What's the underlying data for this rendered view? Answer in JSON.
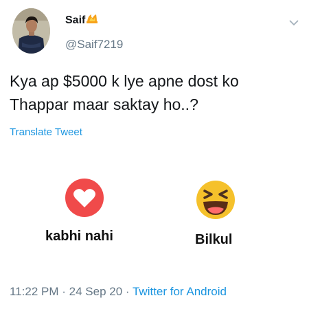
{
  "user": {
    "name": "Saif",
    "handle": "@Saif7219"
  },
  "tweet": {
    "line1": "Kya ap $5000 k lye apne dost ko",
    "line2": "Thappar maar saktay ho..?",
    "translate_label": "Translate Tweet"
  },
  "options": [
    {
      "label": "kabhi nahi",
      "icon": "heart-reaction-icon",
      "color": "#f04a4a"
    },
    {
      "label": "Bilkul",
      "icon": "laughing-emoji-icon",
      "color": "#f5c12b"
    }
  ],
  "footer": {
    "time": "11:22 PM",
    "date": "24 Sep 20",
    "source": "Twitter for Android"
  },
  "colors": {
    "link": "#1b95e0",
    "muted": "#657786"
  }
}
